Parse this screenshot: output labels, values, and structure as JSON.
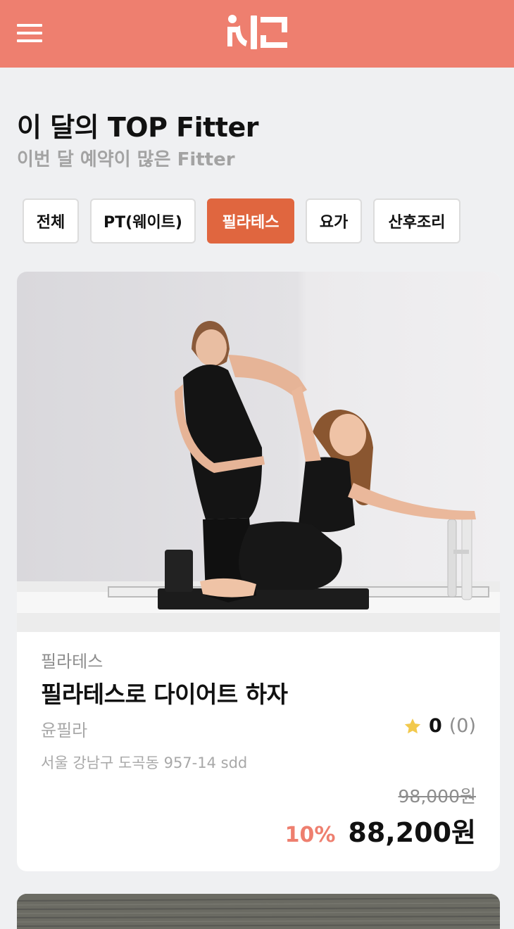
{
  "header": {
    "brand_color": "#ee7f6f",
    "menu_icon": "hamburger-menu-icon",
    "logo_icon": "brand-logo"
  },
  "section": {
    "title": "이 달의 TOP Fitter",
    "subtitle": "이번 달 예약이 많은 Fitter"
  },
  "filters": [
    {
      "label": "전체",
      "active": false
    },
    {
      "label": "PT(웨이트)",
      "active": false
    },
    {
      "label": "필라테스",
      "active": true
    },
    {
      "label": "요가",
      "active": false
    },
    {
      "label": "산후조리",
      "active": false
    }
  ],
  "accent_color": "#e0663f",
  "cards": [
    {
      "category": "필라테스",
      "title": "필라테스로 다이어트 하자",
      "trainer": "윤필라",
      "rating_score": "0",
      "rating_count": "(0)",
      "address": "서울 강남구 도곡동 957-14 sdd",
      "original_price": "98,000원",
      "discount": "10%",
      "price": "88,200원",
      "star_icon": "star-icon",
      "star_color": "#f2c94c"
    }
  ]
}
